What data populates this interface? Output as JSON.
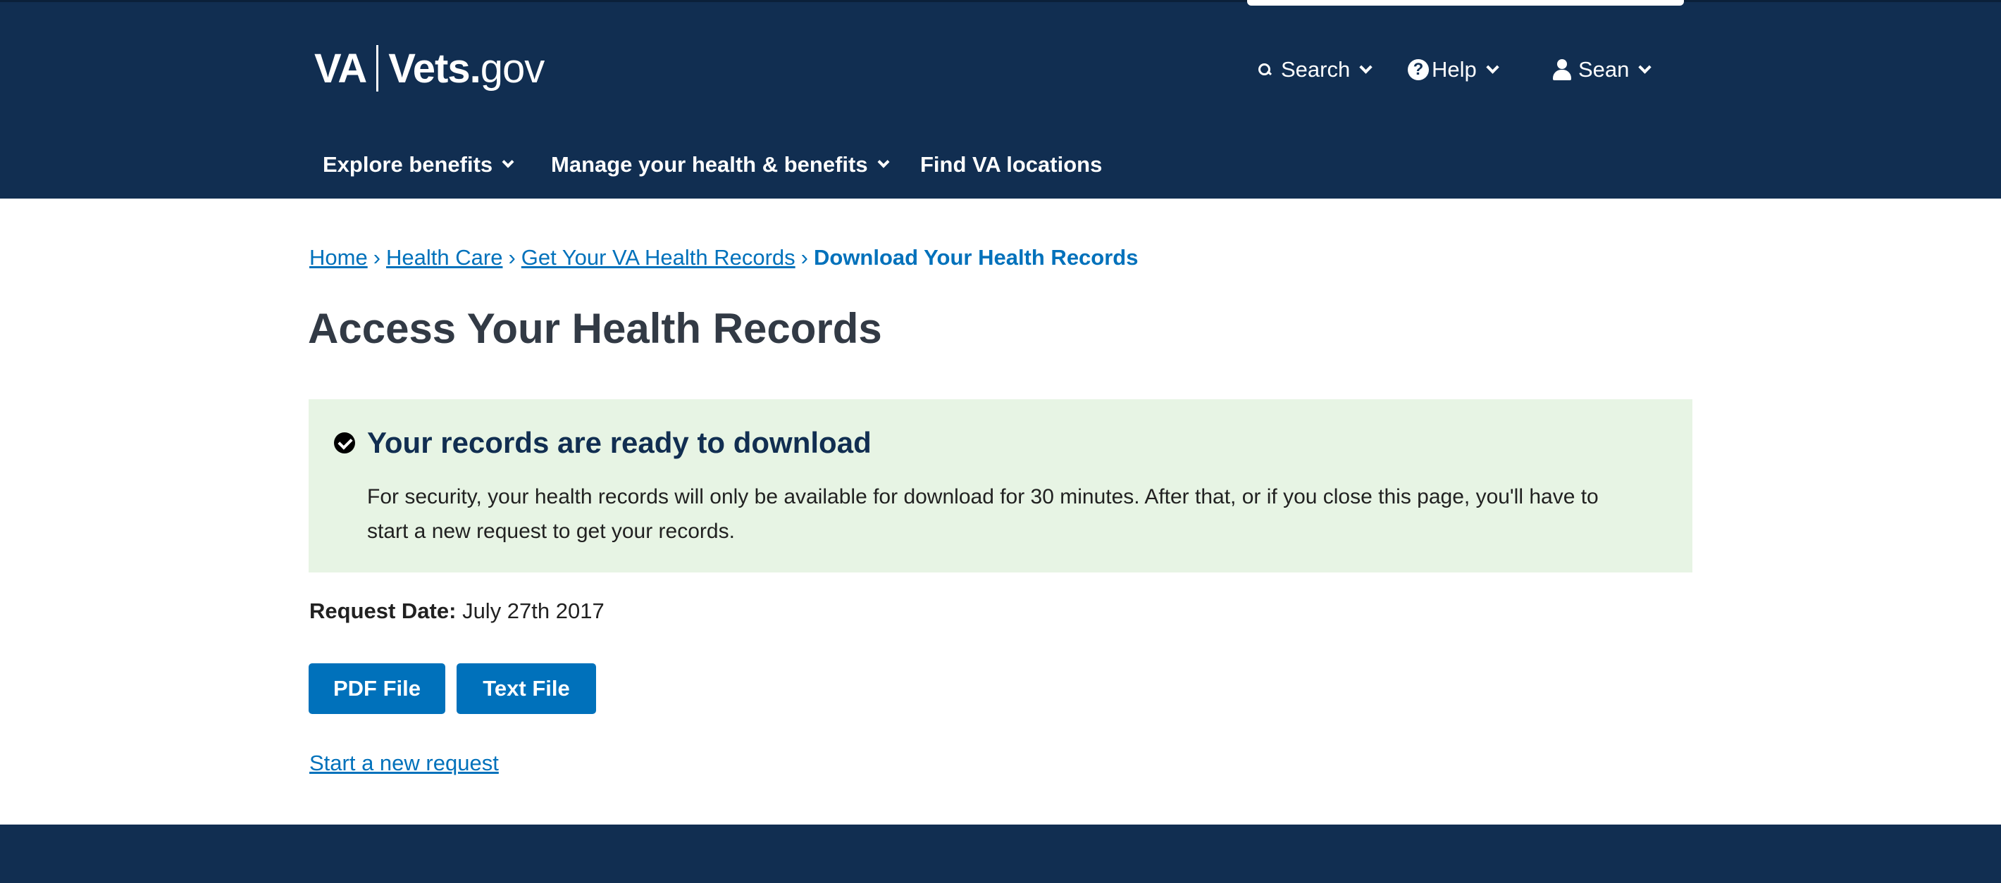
{
  "header": {
    "logo": {
      "va": "VA",
      "vets": "Vets.",
      "gov": "gov"
    },
    "utility_nav": {
      "search_label": "Search",
      "help_label": "Help",
      "user_label": "Sean"
    },
    "main_nav": {
      "explore_label": "Explore benefits",
      "manage_label": "Manage your health & benefits",
      "find_label": "Find VA locations"
    },
    "icons": [
      "search-icon",
      "help-icon",
      "user-icon",
      "chevron-down-icon"
    ],
    "colors": {
      "header_bg": "#112e51"
    }
  },
  "breadcrumb": {
    "items": [
      "Home",
      "Health Care",
      "Get Your VA Health Records"
    ],
    "separator": "›",
    "current": "Download Your Health Records"
  },
  "page": {
    "title": "Access Your Health Records"
  },
  "alert": {
    "icon": "check-circle-icon",
    "title": "Your records are ready to download",
    "body": "For security, your health records will only be available for download for 30 minutes. After that, or if you close this page, you'll have to start a new request to get your records.",
    "colors": {
      "bg": "#e7f4e4"
    }
  },
  "request": {
    "date_label": "Request Date:",
    "date_value": "July 27th 2017"
  },
  "actions": {
    "pdf_label": "PDF File",
    "text_label": "Text File",
    "new_request_label": "Start a new request",
    "colors": {
      "button_bg": "#0071bb",
      "link": "#0071bb"
    }
  }
}
